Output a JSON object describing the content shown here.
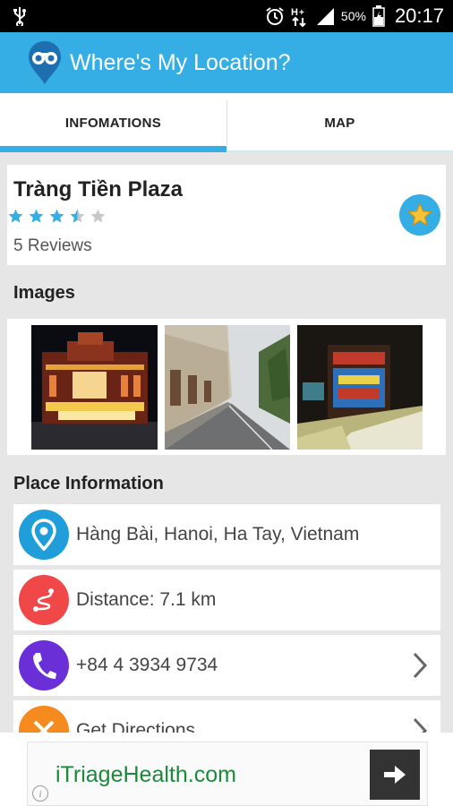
{
  "status_bar": {
    "battery_percent": "50%",
    "time": "20:17",
    "icons": [
      "usb-icon",
      "alarm-icon",
      "data-transfer-icon",
      "signal-icon",
      "battery-icon"
    ]
  },
  "app": {
    "title": "Where's My Location?",
    "accent_color": "#34aee4"
  },
  "tabs": [
    {
      "label": "INFOMATIONS",
      "active": true
    },
    {
      "label": "MAP",
      "active": false
    }
  ],
  "place": {
    "name": "Tràng Tiền Plaza",
    "rating": 3.5,
    "rating_max": 5,
    "reviews": "5 Reviews"
  },
  "images_section": {
    "title": "Images",
    "count": 3
  },
  "place_info": {
    "title": "Place Information",
    "rows": [
      {
        "icon": "location-pin-icon",
        "text": "Hàng Bài, Hanoi, Ha Tay, Vietnam",
        "color": "#1f9ed9",
        "chevron": false
      },
      {
        "icon": "route-icon",
        "text": "Distance: 7.1 km",
        "color": "#f04848",
        "chevron": false
      },
      {
        "icon": "phone-icon",
        "text": "+84 4 3934 9734",
        "color": "#6a2fd6",
        "chevron": true
      },
      {
        "icon": "directions-icon",
        "text": "Get Directions",
        "color": "#f58a1f",
        "chevron": true
      }
    ]
  },
  "ad": {
    "text": "iTriageHealth.com",
    "button_icon": "arrow-right-icon",
    "info_icon": "info-icon"
  }
}
